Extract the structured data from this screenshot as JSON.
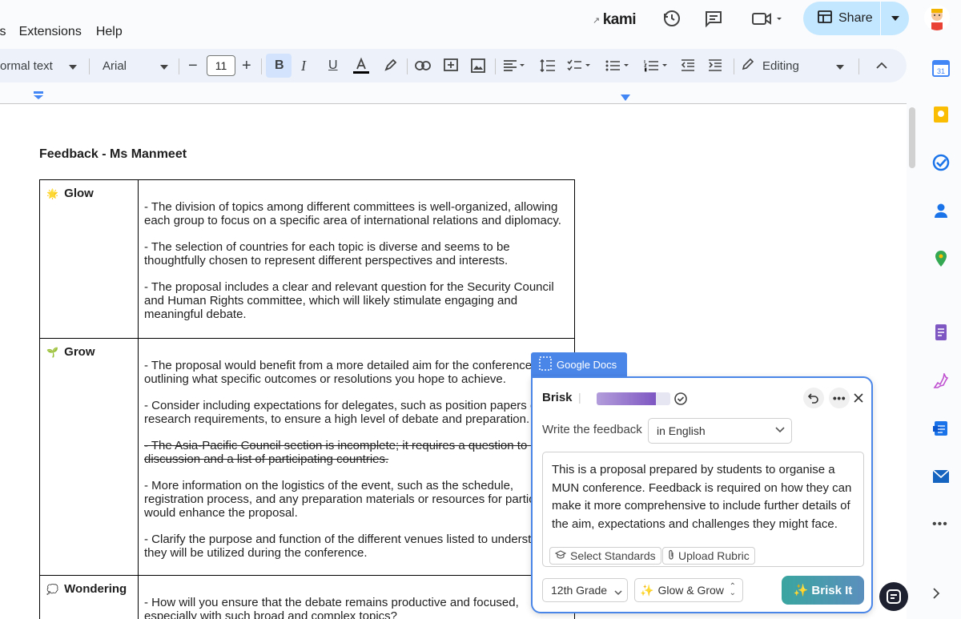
{
  "menu": {
    "items": [
      "ls",
      "Extensions",
      "Help"
    ]
  },
  "header": {
    "kami_label": "kami",
    "share_label": "Share"
  },
  "toolbar": {
    "style": "ormal text",
    "font": "Arial",
    "font_size": "11",
    "mode": "Editing"
  },
  "doc": {
    "title": "Feedback - Ms Manmeet",
    "rows": [
      {
        "label": "Glow",
        "icon": "glow-icon",
        "items": [
          "- The division of topics among different committees is well-organized, allowing each group to focus on a specific area of international relations and diplomacy.",
          "- The selection of countries for each topic is diverse and seems to be thoughtfully chosen to represent different perspectives and interests.",
          "- The proposal includes a clear and relevant question for the Security Council and Human Rights committee, which will likely stimulate engaging and meaningful debate."
        ]
      },
      {
        "label": "Grow",
        "icon": "sprout-icon",
        "items": [
          "- The proposal would benefit from a more detailed aim for the conference, outlining what specific outcomes or resolutions you hope to achieve.",
          "- Consider including expectations for delegates, such as position papers o research requirements, to ensure a high level of debate and preparation.",
          "- The Asia-Pacific Council section is incomplete; it requires a question to g the discussion and a list of participating countries.",
          "- More information on the logistics of the event, such as the schedule, registration process, and any preparation materials or resources for partic would enhance the proposal.",
          "- Clarify the purpose and function of the different venues listed to understa how they will be utilized during the conference."
        ]
      },
      {
        "label": "Wondering",
        "icon": "thought-icon",
        "items": [
          "- How will you ensure that the debate remains productive and focused, especially with such broad and complex topics?"
        ]
      }
    ]
  },
  "brisk": {
    "tab_label": "Google Docs",
    "title": "Brisk",
    "write_label": "Write the feedback",
    "language": "in English",
    "prompt": "This is a proposal prepared by students to organise a MUN conference. Feedback is required on how they can make it more comprehensive to include further details of the aim, expectations and challenges they might face.",
    "select_standards": "Select Standards",
    "upload_rubric": "Upload Rubric",
    "grade": "12th Grade",
    "format": "Glow & Grow",
    "action": "Brisk It"
  },
  "colors": {
    "share_bg": "#c2e7ff",
    "toolbar_bg": "#edf2fa",
    "brisk_border": "#4a86e8",
    "brisk_button": "#3aa5a0"
  }
}
